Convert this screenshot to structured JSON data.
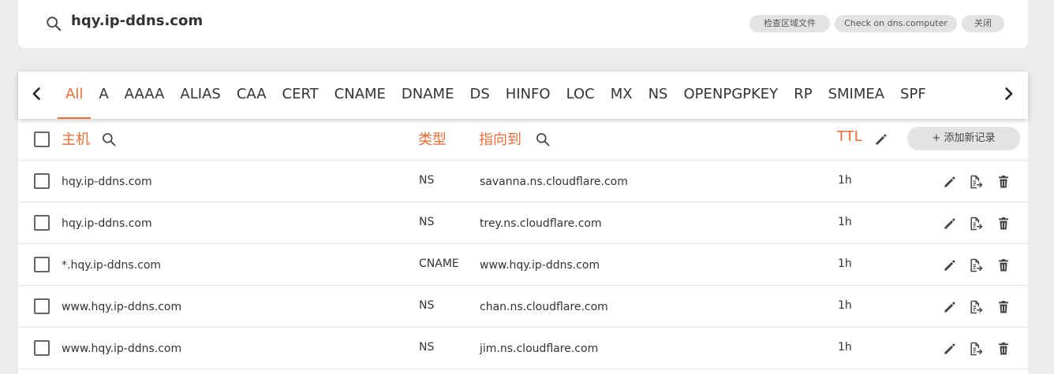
{
  "search": {
    "domain": "hqy.ip-ddns.com",
    "buttons": [
      {
        "label": "检查区域文件"
      },
      {
        "label": "Check on dns.computer"
      },
      {
        "label": "关闭"
      }
    ]
  },
  "tabs": {
    "items": [
      "All",
      "A",
      "AAAA",
      "ALIAS",
      "CAA",
      "CERT",
      "CNAME",
      "DNAME",
      "DS",
      "HINFO",
      "LOC",
      "MX",
      "NS",
      "OPENPGPKEY",
      "RP",
      "SMIMEA",
      "SPF"
    ],
    "active": "All"
  },
  "table": {
    "headers": {
      "host": "主机",
      "type": "类型",
      "points_to": "指向到",
      "ttl": "TTL",
      "add_record": "+ 添加新记录"
    },
    "rows": [
      {
        "host": "hqy.ip-ddns.com",
        "type": "NS",
        "value": "savanna.ns.cloudflare.com",
        "ttl": "1h"
      },
      {
        "host": "hqy.ip-ddns.com",
        "type": "NS",
        "value": "trey.ns.cloudflare.com",
        "ttl": "1h"
      },
      {
        "host": "*.hqy.ip-ddns.com",
        "type": "CNAME",
        "value": "www.hqy.ip-ddns.com",
        "ttl": "1h"
      },
      {
        "host": "www.hqy.ip-ddns.com",
        "type": "NS",
        "value": "chan.ns.cloudflare.com",
        "ttl": "1h"
      },
      {
        "host": "www.hqy.ip-ddns.com",
        "type": "NS",
        "value": "jim.ns.cloudflare.com",
        "ttl": "1h"
      }
    ]
  },
  "colors": {
    "accent": "#ef6c35",
    "text": "#333333",
    "pill_bg": "#e3e3e3",
    "page_bg": "#ececec"
  }
}
